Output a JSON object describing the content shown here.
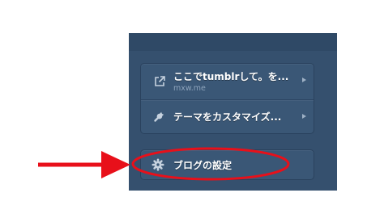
{
  "menu": {
    "items": [
      {
        "label": "ここでtumblrして。を...",
        "sublabel": "mxw.me",
        "icon": "external-link-icon"
      },
      {
        "label": "テーマをカスタマイズ...",
        "icon": "wrench-icon"
      },
      {
        "label": "ブログの設定",
        "icon": "gear-icon"
      }
    ]
  },
  "annotation": {
    "arrow_color": "#e8101a",
    "highlight_color": "#e8101a"
  },
  "colors": {
    "panel": "#35506e",
    "item": "#3a5776",
    "text": "#ffffff",
    "subtext": "#8ea4bc"
  }
}
